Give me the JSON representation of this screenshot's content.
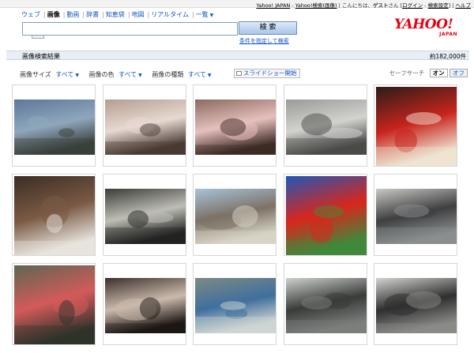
{
  "topbar": {
    "yahoo_japan": "Yahoo! JAPAN",
    "separator": "-",
    "yahoo_search": "Yahoo!検索(画像)",
    "divider": "|",
    "greeting": "こんにちは、",
    "guest": "ゲスト",
    "san": "さん",
    "bracket_open": "[",
    "login": "ログイン",
    "dash": "-",
    "search_settings": "検索設定",
    "bracket_close": "]",
    "help": "ヘルプ"
  },
  "nav": {
    "items": [
      "ウェブ",
      "画像",
      "動画",
      "辞書",
      "知恵袋",
      "地図",
      "リアルタイム",
      "一覧"
    ],
    "active_index": 1
  },
  "search": {
    "value": "",
    "button_label": "検 索",
    "advanced_link": "条件を指定して検索"
  },
  "logo": {
    "main": "YAHOO!",
    "sub": "JAPAN"
  },
  "results": {
    "title": "画像検索結果",
    "count": "約182,000件"
  },
  "filters": {
    "size_label": "画像サイズ",
    "size_value": "すべて",
    "color_label": "画像の色",
    "color_value": "すべて",
    "type_label": "画像の種類",
    "type_value": "すべて",
    "slideshow_label": "スライドショー開始"
  },
  "safesearch": {
    "label": "セーフサーチ",
    "on": "オン",
    "off": "オフ"
  },
  "images": [
    {
      "name": "stadium-sky-thumbnail",
      "colors": [
        "#5c7899",
        "#8fa7bd",
        "#3a3f3a"
      ]
    },
    {
      "name": "cherry-blossom-branch-thumbnail",
      "colors": [
        "#b49e90",
        "#e7d9d1",
        "#4a3a34"
      ]
    },
    {
      "name": "pink-sakura-closeup-thumbnail",
      "colors": [
        "#8a6a5e",
        "#e6c0bd",
        "#3d2a26"
      ]
    },
    {
      "name": "winter-campsite-thumbnail",
      "colors": [
        "#9a9a96",
        "#d2d2cf",
        "#4a4a48"
      ]
    },
    {
      "name": "red-chairs-thumbnail",
      "colors": [
        "#2b1c18",
        "#c8241d",
        "#efe4d2"
      ]
    },
    {
      "name": "cat-on-leaves-thumbnail",
      "colors": [
        "#3b2d24",
        "#7a5a44",
        "#e8e4de"
      ]
    },
    {
      "name": "stone-monument-thumbnail",
      "colors": [
        "#3c3c38",
        "#bebeb6",
        "#232321"
      ]
    },
    {
      "name": "beach-horizon-thumbnail",
      "colors": [
        "#a8c2d9",
        "#7c7266",
        "#d8d3c6"
      ]
    },
    {
      "name": "red-hibiscus-blue-sky-thumbnail",
      "colors": [
        "#1f58b8",
        "#d8261c",
        "#3f8a3a"
      ]
    },
    {
      "name": "train-platform-thumbnail",
      "colors": [
        "#c8c8c4",
        "#3f3f40",
        "#8a8e90"
      ]
    },
    {
      "name": "faded-red-flower-thumbnail",
      "colors": [
        "#5d6752",
        "#d45a5a",
        "#2f332a"
      ]
    },
    {
      "name": "cherry-tree-dark-thumbnail",
      "colors": [
        "#3b312c",
        "#cbb9ac",
        "#1e1715"
      ]
    },
    {
      "name": "blue-tents-thumbnail",
      "colors": [
        "#7d8a84",
        "#3f6f9e",
        "#cfd6d2"
      ]
    },
    {
      "name": "bare-trees-thumbnail",
      "colors": [
        "#cfd1cf",
        "#3a3c3a",
        "#7b7e7c"
      ]
    },
    {
      "name": "train-station-bw-thumbnail",
      "colors": [
        "#d3d3d0",
        "#2f2f2f",
        "#8a8a88"
      ]
    }
  ]
}
